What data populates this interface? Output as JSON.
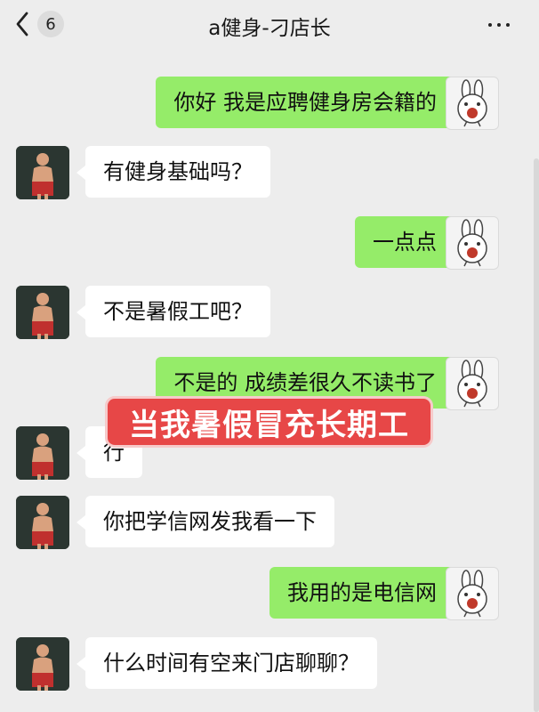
{
  "header": {
    "back_badge": "6",
    "title": "a健身-刁店长"
  },
  "messages": [
    {
      "side": "right",
      "text": "你好 我是应聘健身房会籍的"
    },
    {
      "side": "left",
      "text": "有健身基础吗？"
    },
    {
      "side": "right",
      "text": "一点点"
    },
    {
      "side": "left",
      "text": "不是暑假工吧？"
    },
    {
      "side": "right",
      "text": "不是的 成绩差很久不读书了"
    },
    {
      "side": "left",
      "text": "行"
    },
    {
      "side": "left",
      "text": "你把学信网发我看一下"
    },
    {
      "side": "right",
      "text": "我用的是电信网"
    },
    {
      "side": "left",
      "text": "什么时间有空来门店聊聊？"
    }
  ],
  "overlay_caption": "当我暑假冒充长期工",
  "colors": {
    "background": "#ededed",
    "bubble_self": "#95ec69",
    "bubble_other": "#ffffff",
    "overlay": "#e74747"
  }
}
